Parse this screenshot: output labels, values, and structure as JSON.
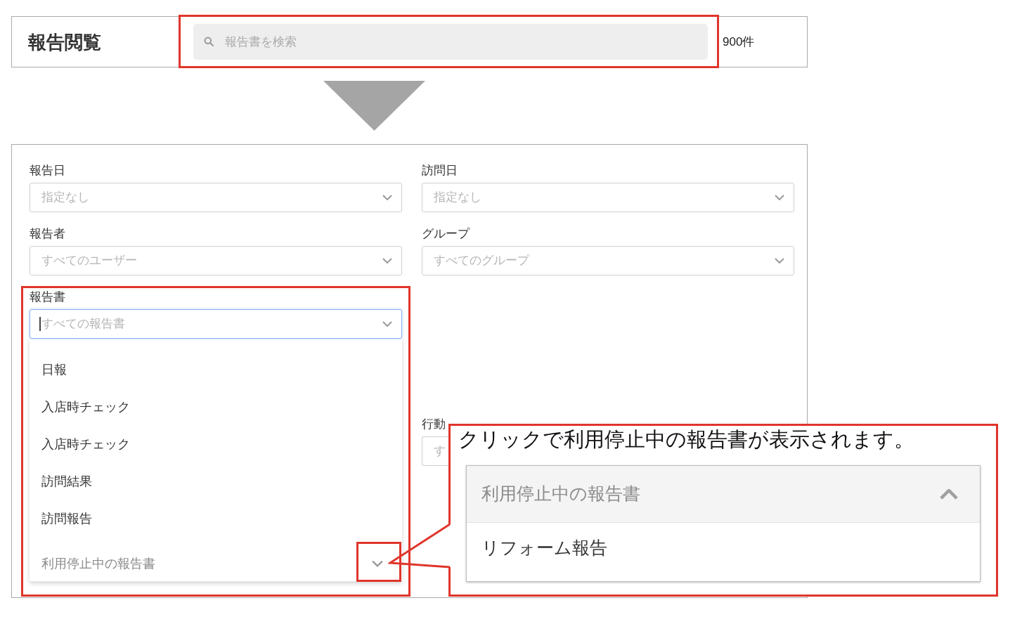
{
  "header": {
    "title": "報告閲覧",
    "search": {
      "placeholder": "報告書を検索"
    },
    "count": "900件"
  },
  "filter_panel": {
    "left_column": [
      {
        "kind": "select",
        "label": "報告日",
        "placeholder": "指定なし",
        "focused": false
      },
      {
        "kind": "select",
        "label": "報告者",
        "placeholder": "すべてのユーザー",
        "focused": false
      },
      {
        "kind": "select",
        "label": "報告書",
        "placeholder": "すべての報告書",
        "focused": true,
        "dropdown": {
          "options": [
            "日報",
            "入店時チェック",
            "入店時チェック",
            "訪問結果",
            "訪問報告"
          ],
          "group": {
            "label": "利用停止中の報告書",
            "expanded": false
          }
        }
      }
    ],
    "right_column": [
      {
        "kind": "select",
        "label": "訪問日",
        "placeholder": "指定なし",
        "focused": false
      },
      {
        "kind": "select",
        "label": "グループ",
        "placeholder": "すべてのグループ",
        "focused": false
      },
      {
        "kind": "select_covered",
        "label": "行動",
        "placeholder": "す",
        "focused": false
      }
    ]
  },
  "callout": {
    "text": "クリックで利用停止中の報告書が表示されます。",
    "group": {
      "label": "利用停止中の報告書",
      "expanded": true,
      "options": [
        "リフォーム報告"
      ]
    }
  }
}
